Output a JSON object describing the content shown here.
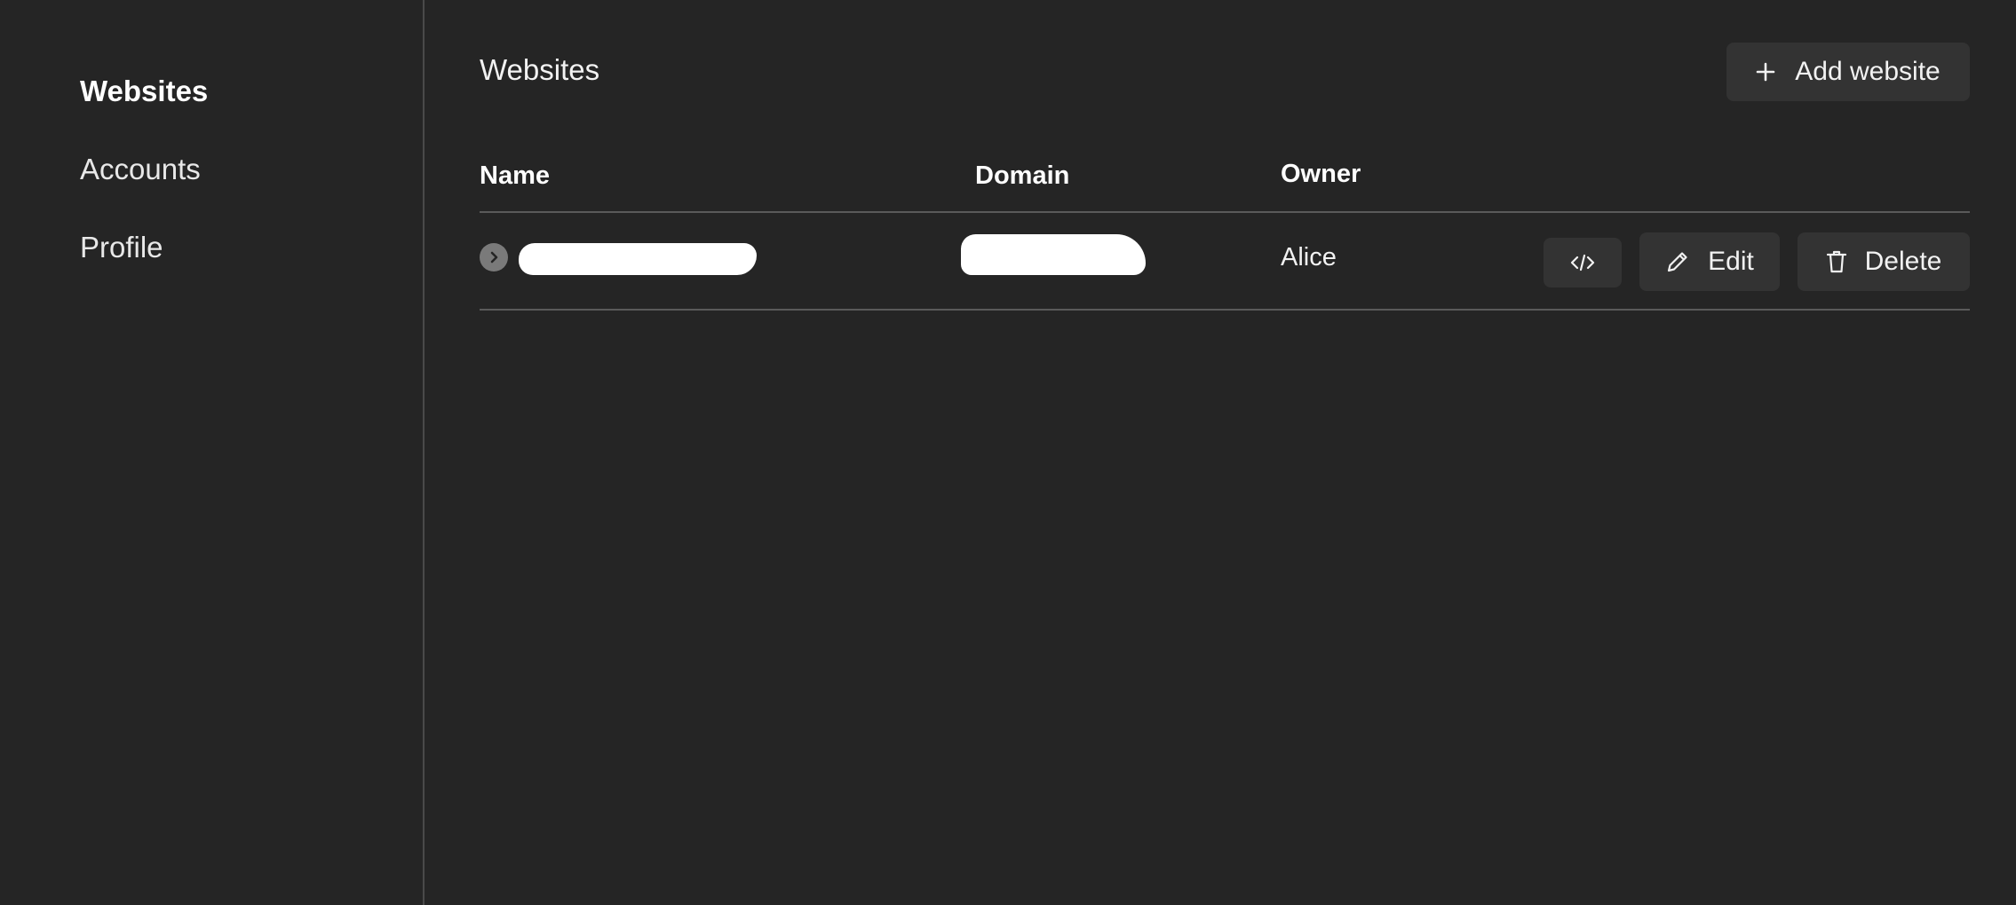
{
  "sidebar": {
    "items": [
      {
        "label": "Websites",
        "active": true
      },
      {
        "label": "Accounts",
        "active": false
      },
      {
        "label": "Profile",
        "active": false
      }
    ]
  },
  "main": {
    "title": "Websites",
    "add_button_label": "Add website",
    "table": {
      "columns": [
        "Name",
        "Domain",
        "Owner"
      ],
      "rows": [
        {
          "owner": "Alice",
          "edit_label": "Edit",
          "delete_label": "Delete"
        }
      ]
    }
  },
  "icons": {
    "add": "plus-icon",
    "expand": "chevron-right-icon",
    "code": "code-icon",
    "edit": "pencil-icon",
    "delete": "trash-icon"
  },
  "colors": {
    "background": "#252525",
    "button": "#333333",
    "divider": "#5a5a5a",
    "text": "#ffffff"
  }
}
